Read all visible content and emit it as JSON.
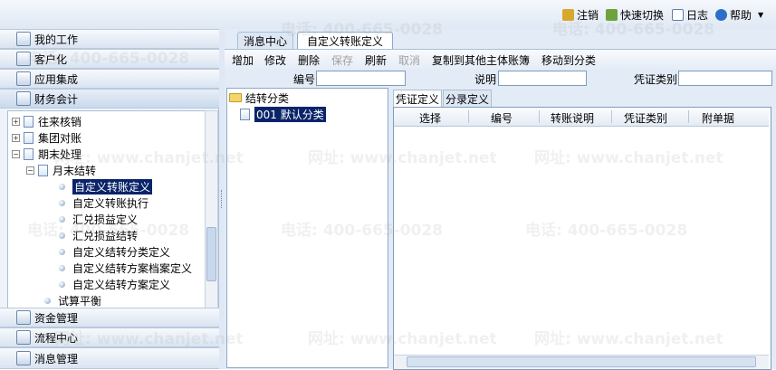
{
  "header": {
    "logout_label": "注销",
    "quick_switch_label": "快速切换",
    "log_label": "日志",
    "help_label": "帮助"
  },
  "sidebar": {
    "sections_top": [
      {
        "label": "我的工作",
        "icon": "my-work-icon"
      },
      {
        "label": "客户化",
        "icon": "customize-icon"
      },
      {
        "label": "应用集成",
        "icon": "app-integration-icon"
      },
      {
        "label": "财务会计",
        "icon": "finance-icon",
        "active": true
      }
    ],
    "tree": [
      {
        "label": "往来核销"
      },
      {
        "label": "集团对账"
      },
      {
        "label": "期末处理"
      },
      {
        "label": "月末结转"
      },
      {
        "label": "自定义转账定义",
        "selected": true
      },
      {
        "label": "自定义转账执行"
      },
      {
        "label": "汇兑损益定义"
      },
      {
        "label": "汇兑损益结转"
      },
      {
        "label": "自定义结转分类定义"
      },
      {
        "label": "自定义结转方案档案定义"
      },
      {
        "label": "自定义结转方案定义"
      },
      {
        "label": "试算平衡"
      }
    ],
    "sections_bottom": [
      {
        "label": "资金管理",
        "icon": "fund-icon"
      },
      {
        "label": "流程中心",
        "icon": "process-icon"
      },
      {
        "label": "消息管理",
        "icon": "message-icon"
      }
    ]
  },
  "tabs": [
    {
      "label": "消息中心"
    },
    {
      "label": "自定义转账定义",
      "active": true
    }
  ],
  "toolbar": {
    "add": "增加",
    "edit": "修改",
    "delete": "删除",
    "save": "保存",
    "refresh": "刷新",
    "cancel": "取消",
    "copy_to": "复制到其他主体账簿",
    "move_to": "移动到分类"
  },
  "filters": {
    "number_label": "编号",
    "number_value": "",
    "desc_label": "说明",
    "desc_value": "",
    "voucher_type_label": "凭证类别",
    "voucher_type_value": ""
  },
  "class_tree": {
    "root": "结转分类",
    "child": "001 默认分类"
  },
  "inner_tabs": [
    {
      "label": "凭证定义",
      "active": true
    },
    {
      "label": "分录定义"
    }
  ],
  "grid": {
    "columns": [
      "选择",
      "编号",
      "转账说明",
      "凭证类别",
      "附单据"
    ]
  },
  "watermark": {
    "phone": "电话: 400-665-0028",
    "site": "网址: www.chanjet.net"
  }
}
